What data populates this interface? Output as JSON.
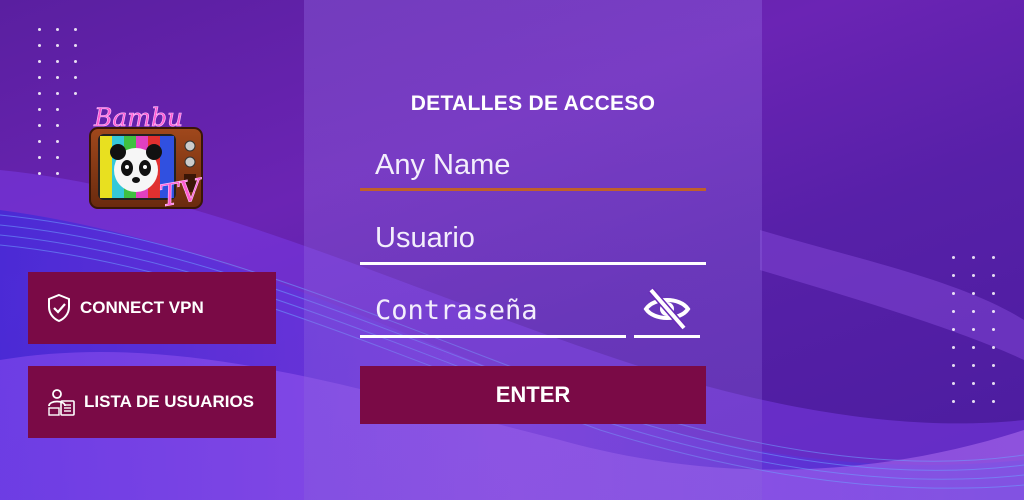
{
  "brand": {
    "logo_text_top": "Bambu",
    "logo_text_bottom": "TV"
  },
  "sidebar": {
    "connect_vpn_label": "CONNECT VPN",
    "user_list_label": "LISTA DE USUARIOS"
  },
  "login": {
    "title": "DETALLES DE ACCESO",
    "name_placeholder": "Any Name",
    "user_placeholder": "Usuario",
    "password_placeholder": "Contraseña",
    "enter_label": "ENTER"
  },
  "colors": {
    "button_bg": "#7a0a46",
    "active_underline": "#c0602a",
    "underline": "#ffffff",
    "background": "#5a1fa0"
  },
  "icons": {
    "vpn": "shield-check-icon",
    "users": "user-list-icon",
    "password_toggle": "eye-off-icon"
  }
}
